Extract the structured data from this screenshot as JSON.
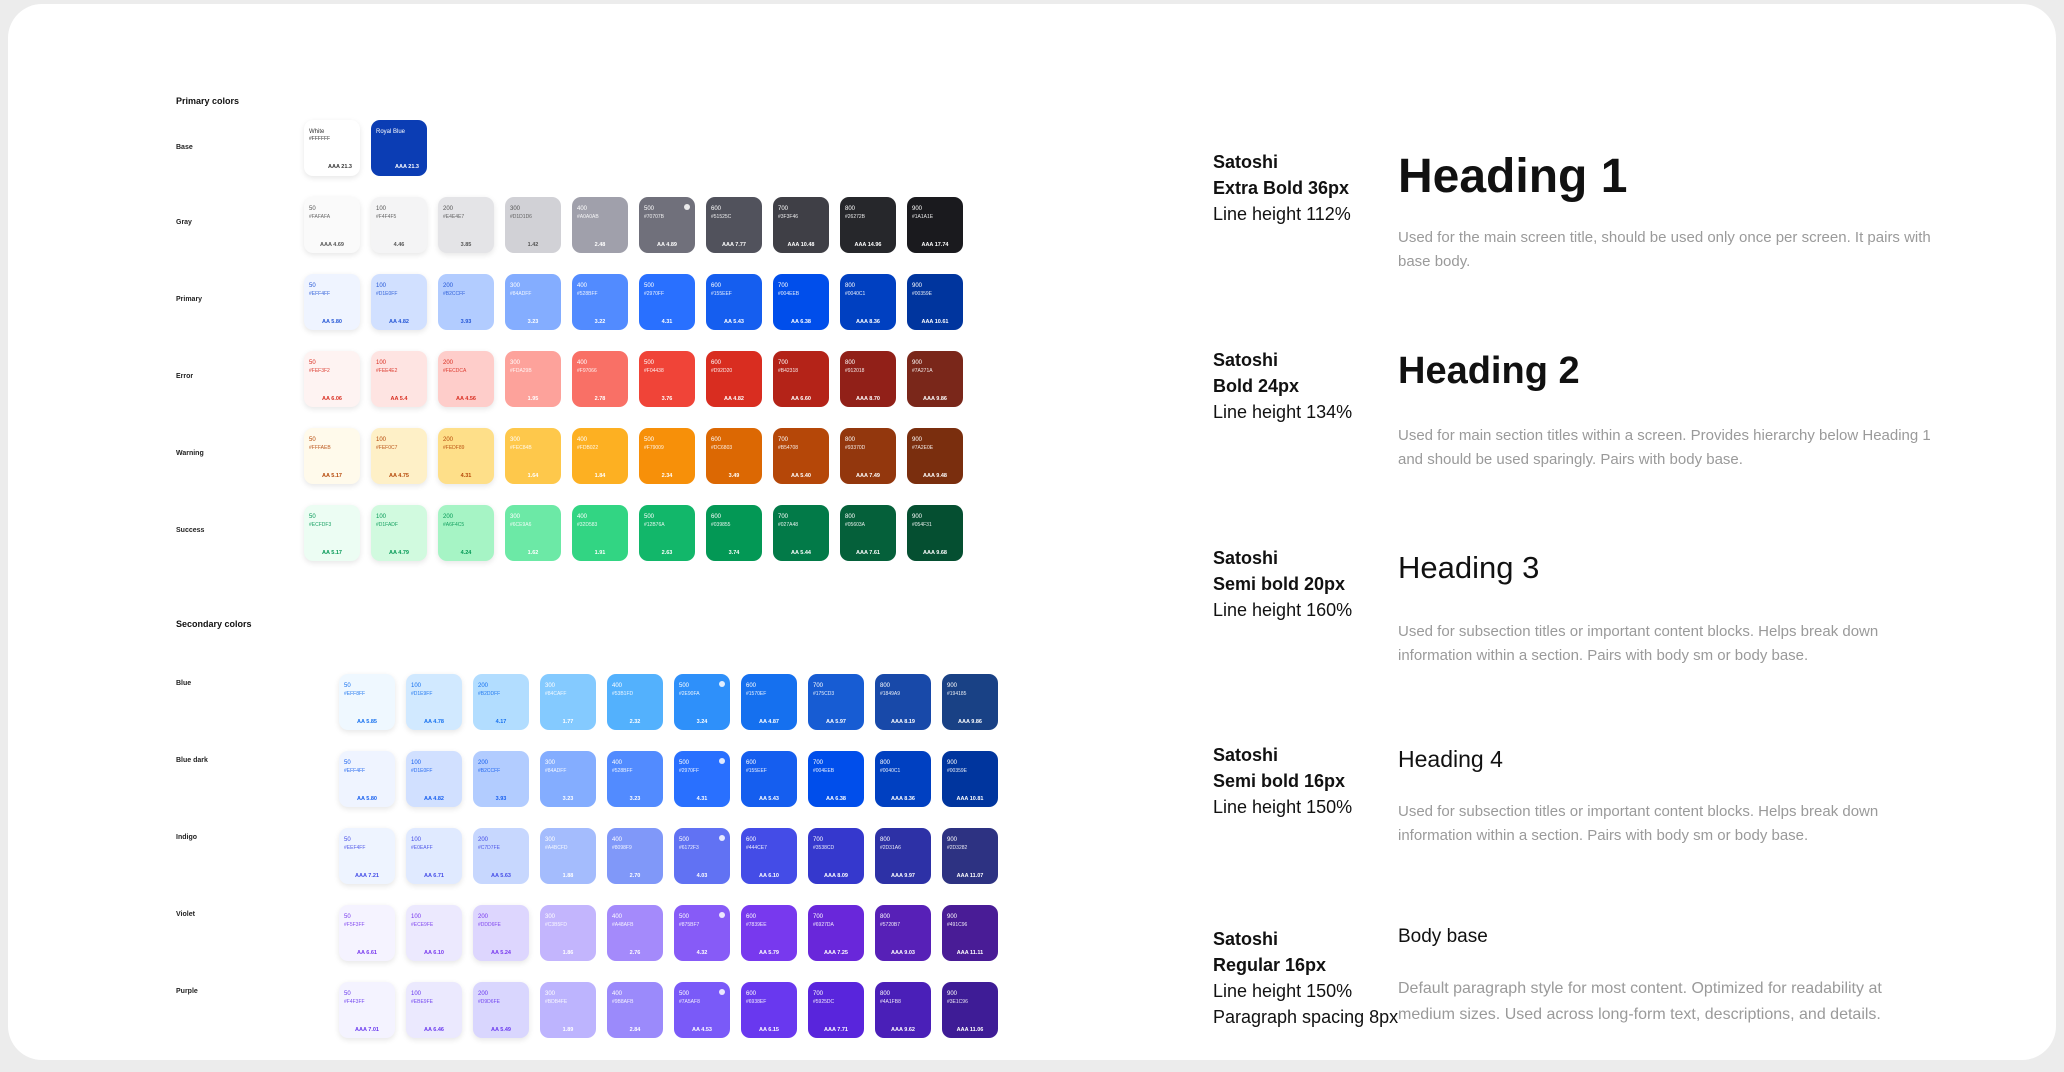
{
  "primary_title": "Primary colors",
  "secondary_title": "Secondary colors",
  "base_row": {
    "label": "Base",
    "swatches": [
      {
        "name": "White",
        "hex": "#FFFFFF",
        "ratio": "AAA 21.3",
        "bg": "#FFFFFF",
        "text": "#333333"
      },
      {
        "name": "Royal Blue",
        "hex": "",
        "ratio": "AAA 21.3",
        "bg": "#0B3DB4",
        "text": "#FFFFFF"
      }
    ]
  },
  "primary_rows": [
    {
      "label": "Gray",
      "swatches": [
        {
          "shade": "50",
          "hex": "#FAFAFA",
          "ratio": "AAA 4.69",
          "bg": "#FAFAFA",
          "text": "#555555"
        },
        {
          "shade": "100",
          "hex": "#F4F4F5",
          "ratio": "4.46",
          "bg": "#F4F4F5",
          "text": "#555555"
        },
        {
          "shade": "200",
          "hex": "#E4E4E7",
          "ratio": "3.85",
          "bg": "#E4E4E7",
          "text": "#555555"
        },
        {
          "shade": "300",
          "hex": "#D1D1D6",
          "ratio": "1.42",
          "bg": "#D1D1D6",
          "text": "#555555"
        },
        {
          "shade": "400",
          "hex": "#A0A0AB",
          "ratio": "2.48",
          "bg": "#A0A0AB",
          "text": "#FFFFFF"
        },
        {
          "shade": "500",
          "hex": "#70707B",
          "ratio": "AA 4.89",
          "bg": "#70707B",
          "text": "#FFFFFF",
          "dot": true
        },
        {
          "shade": "600",
          "hex": "#51525C",
          "ratio": "AAA 7.77",
          "bg": "#51525C",
          "text": "#FFFFFF"
        },
        {
          "shade": "700",
          "hex": "#3F3F46",
          "ratio": "AAA 10.48",
          "bg": "#3F3F46",
          "text": "#FFFFFF"
        },
        {
          "shade": "800",
          "hex": "#26272B",
          "ratio": "AAA 14.96",
          "bg": "#26272B",
          "text": "#FFFFFF"
        },
        {
          "shade": "900",
          "hex": "#1A1A1E",
          "ratio": "AAA 17.74",
          "bg": "#1A1A1E",
          "text": "#FFFFFF"
        }
      ]
    },
    {
      "label": "Primary",
      "swatches": [
        {
          "shade": "50",
          "hex": "#EFF4FF",
          "ratio": "AA 5.80",
          "bg": "#EFF4FF",
          "text": "#2456D6"
        },
        {
          "shade": "100",
          "hex": "#D1E0FF",
          "ratio": "AA 4.82",
          "bg": "#D1E0FF",
          "text": "#2456D6"
        },
        {
          "shade": "200",
          "hex": "#B2CCFF",
          "ratio": "3.93",
          "bg": "#B2CCFF",
          "text": "#2456D6"
        },
        {
          "shade": "300",
          "hex": "#84ADFF",
          "ratio": "3.23",
          "bg": "#84ADFF",
          "text": "#FFFFFF"
        },
        {
          "shade": "400",
          "hex": "#528BFF",
          "ratio": "3.22",
          "bg": "#528BFF",
          "text": "#FFFFFF"
        },
        {
          "shade": "500",
          "hex": "#2970FF",
          "ratio": "4.31",
          "bg": "#2970FF",
          "text": "#FFFFFF"
        },
        {
          "shade": "600",
          "hex": "#155EEF",
          "ratio": "AA 5.43",
          "bg": "#155EEF",
          "text": "#FFFFFF"
        },
        {
          "shade": "700",
          "hex": "#004EEB",
          "ratio": "AA 6.38",
          "bg": "#004EEB",
          "text": "#FFFFFF"
        },
        {
          "shade": "800",
          "hex": "#0040C1",
          "ratio": "AAA 8.36",
          "bg": "#0040C1",
          "text": "#FFFFFF"
        },
        {
          "shade": "900",
          "hex": "#00359E",
          "ratio": "AAA 10.61",
          "bg": "#00359E",
          "text": "#FFFFFF"
        }
      ]
    },
    {
      "label": "Error",
      "swatches": [
        {
          "shade": "50",
          "hex": "#FEF3F2",
          "ratio": "AA 6.06",
          "bg": "#FEF3F2",
          "text": "#D92D20"
        },
        {
          "shade": "100",
          "hex": "#FEE4E2",
          "ratio": "AA 5.4",
          "bg": "#FEE4E2",
          "text": "#D92D20"
        },
        {
          "shade": "200",
          "hex": "#FECDCA",
          "ratio": "AA 4.56",
          "bg": "#FECDCA",
          "text": "#D92D20"
        },
        {
          "shade": "300",
          "hex": "#FDA29B",
          "ratio": "1.95",
          "bg": "#FDA29B",
          "text": "#FFFFFF"
        },
        {
          "shade": "400",
          "hex": "#F97066",
          "ratio": "2.78",
          "bg": "#F97066",
          "text": "#FFFFFF"
        },
        {
          "shade": "500",
          "hex": "#F04438",
          "ratio": "3.76",
          "bg": "#F04438",
          "text": "#FFFFFF"
        },
        {
          "shade": "600",
          "hex": "#D92D20",
          "ratio": "AA 4.82",
          "bg": "#D92D20",
          "text": "#FFFFFF"
        },
        {
          "shade": "700",
          "hex": "#B42318",
          "ratio": "AA 6.60",
          "bg": "#B42318",
          "text": "#FFFFFF"
        },
        {
          "shade": "800",
          "hex": "#912018",
          "ratio": "AAA 8.70",
          "bg": "#912018",
          "text": "#FFFFFF"
        },
        {
          "shade": "900",
          "hex": "#7A271A",
          "ratio": "AAA 9.86",
          "bg": "#7A271A",
          "text": "#FFFFFF"
        }
      ]
    },
    {
      "label": "Warning",
      "swatches": [
        {
          "shade": "50",
          "hex": "#FFFAEB",
          "ratio": "AA 5.17",
          "bg": "#FFFAEB",
          "text": "#B54708"
        },
        {
          "shade": "100",
          "hex": "#FEF0C7",
          "ratio": "AA 4.75",
          "bg": "#FEF0C7",
          "text": "#B54708"
        },
        {
          "shade": "200",
          "hex": "#FEDF89",
          "ratio": "4.31",
          "bg": "#FEDF89",
          "text": "#B54708"
        },
        {
          "shade": "300",
          "hex": "#FEC84B",
          "ratio": "1.64",
          "bg": "#FEC84B",
          "text": "#FFFFFF"
        },
        {
          "shade": "400",
          "hex": "#FDB022",
          "ratio": "1.84",
          "bg": "#FDB022",
          "text": "#FFFFFF"
        },
        {
          "shade": "500",
          "hex": "#F79009",
          "ratio": "2.34",
          "bg": "#F79009",
          "text": "#FFFFFF"
        },
        {
          "shade": "600",
          "hex": "#DC6803",
          "ratio": "3.49",
          "bg": "#DC6803",
          "text": "#FFFFFF"
        },
        {
          "shade": "700",
          "hex": "#B54708",
          "ratio": "AA 5.40",
          "bg": "#B54708",
          "text": "#FFFFFF"
        },
        {
          "shade": "800",
          "hex": "#93370D",
          "ratio": "AAA 7.49",
          "bg": "#93370D",
          "text": "#FFFFFF"
        },
        {
          "shade": "900",
          "hex": "#7A2E0E",
          "ratio": "AAA 9.48",
          "bg": "#7A2E0E",
          "text": "#FFFFFF"
        }
      ]
    },
    {
      "label": "Success",
      "swatches": [
        {
          "shade": "50",
          "hex": "#ECFDF3",
          "ratio": "AA 5.17",
          "bg": "#ECFDF3",
          "text": "#039855"
        },
        {
          "shade": "100",
          "hex": "#D1FADF",
          "ratio": "AA 4.79",
          "bg": "#D1FADF",
          "text": "#039855"
        },
        {
          "shade": "200",
          "hex": "#A6F4C5",
          "ratio": "4.24",
          "bg": "#A6F4C5",
          "text": "#039855"
        },
        {
          "shade": "300",
          "hex": "#6CE9A6",
          "ratio": "1.62",
          "bg": "#6CE9A6",
          "text": "#FFFFFF"
        },
        {
          "shade": "400",
          "hex": "#32D583",
          "ratio": "1.91",
          "bg": "#32D583",
          "text": "#FFFFFF"
        },
        {
          "shade": "500",
          "hex": "#12B76A",
          "ratio": "2.63",
          "bg": "#12B76A",
          "text": "#FFFFFF"
        },
        {
          "shade": "600",
          "hex": "#039855",
          "ratio": "3.74",
          "bg": "#039855",
          "text": "#FFFFFF"
        },
        {
          "shade": "700",
          "hex": "#027A48",
          "ratio": "AA 5.44",
          "bg": "#027A48",
          "text": "#FFFFFF"
        },
        {
          "shade": "800",
          "hex": "#05603A",
          "ratio": "AAA 7.61",
          "bg": "#05603A",
          "text": "#FFFFFF"
        },
        {
          "shade": "900",
          "hex": "#054F31",
          "ratio": "AAA 9.68",
          "bg": "#054F31",
          "text": "#FFFFFF"
        }
      ]
    }
  ],
  "secondary_rows": [
    {
      "label": "Blue",
      "swatches": [
        {
          "shade": "50",
          "hex": "#EFF8FF",
          "ratio": "AA 5.85",
          "bg": "#EFF8FF",
          "text": "#1570EF"
        },
        {
          "shade": "100",
          "hex": "#D1E9FF",
          "ratio": "AA 4.78",
          "bg": "#D1E9FF",
          "text": "#1570EF"
        },
        {
          "shade": "200",
          "hex": "#B2DDFF",
          "ratio": "4.17",
          "bg": "#B2DDFF",
          "text": "#1570EF"
        },
        {
          "shade": "300",
          "hex": "#84CAFF",
          "ratio": "1.77",
          "bg": "#84CAFF",
          "text": "#FFFFFF"
        },
        {
          "shade": "400",
          "hex": "#53B1FD",
          "ratio": "2.32",
          "bg": "#53B1FD",
          "text": "#FFFFFF"
        },
        {
          "shade": "500",
          "hex": "#2E90FA",
          "ratio": "3.24",
          "bg": "#2E90FA",
          "text": "#FFFFFF",
          "dot": true
        },
        {
          "shade": "600",
          "hex": "#1570EF",
          "ratio": "AA 4.87",
          "bg": "#1570EF",
          "text": "#FFFFFF"
        },
        {
          "shade": "700",
          "hex": "#175CD3",
          "ratio": "AA 5.97",
          "bg": "#175CD3",
          "text": "#FFFFFF"
        },
        {
          "shade": "800",
          "hex": "#1849A9",
          "ratio": "AAA 8.19",
          "bg": "#1849A9",
          "text": "#FFFFFF"
        },
        {
          "shade": "900",
          "hex": "#194185",
          "ratio": "AAA 9.86",
          "bg": "#194185",
          "text": "#FFFFFF"
        }
      ]
    },
    {
      "label": "Blue dark",
      "swatches": [
        {
          "shade": "50",
          "hex": "#EFF4FF",
          "ratio": "AA 5.80",
          "bg": "#EFF4FF",
          "text": "#155EEF"
        },
        {
          "shade": "100",
          "hex": "#D1E0FF",
          "ratio": "AA 4.82",
          "bg": "#D1E0FF",
          "text": "#155EEF"
        },
        {
          "shade": "200",
          "hex": "#B2CCFF",
          "ratio": "3.93",
          "bg": "#B2CCFF",
          "text": "#155EEF"
        },
        {
          "shade": "300",
          "hex": "#84ADFF",
          "ratio": "3.23",
          "bg": "#84ADFF",
          "text": "#FFFFFF"
        },
        {
          "shade": "400",
          "hex": "#528BFF",
          "ratio": "3.23",
          "bg": "#528BFF",
          "text": "#FFFFFF"
        },
        {
          "shade": "500",
          "hex": "#2970FF",
          "ratio": "4.31",
          "bg": "#2970FF",
          "text": "#FFFFFF",
          "dot": true
        },
        {
          "shade": "600",
          "hex": "#155EEF",
          "ratio": "AA 5.43",
          "bg": "#155EEF",
          "text": "#FFFFFF"
        },
        {
          "shade": "700",
          "hex": "#004EEB",
          "ratio": "AA 6.38",
          "bg": "#004EEB",
          "text": "#FFFFFF"
        },
        {
          "shade": "800",
          "hex": "#0040C1",
          "ratio": "AAA 8.36",
          "bg": "#0040C1",
          "text": "#FFFFFF"
        },
        {
          "shade": "900",
          "hex": "#00359E",
          "ratio": "AAA 10.81",
          "bg": "#00359E",
          "text": "#FFFFFF"
        }
      ]
    },
    {
      "label": "Indigo",
      "swatches": [
        {
          "shade": "50",
          "hex": "#EEF4FF",
          "ratio": "AAA 7.21",
          "bg": "#EEF4FF",
          "text": "#444CE7"
        },
        {
          "shade": "100",
          "hex": "#E0EAFF",
          "ratio": "AA 6.71",
          "bg": "#E0EAFF",
          "text": "#444CE7"
        },
        {
          "shade": "200",
          "hex": "#C7D7FE",
          "ratio": "AA 5.63",
          "bg": "#C7D7FE",
          "text": "#444CE7"
        },
        {
          "shade": "300",
          "hex": "#A4BCFD",
          "ratio": "1.88",
          "bg": "#A4BCFD",
          "text": "#FFFFFF"
        },
        {
          "shade": "400",
          "hex": "#8098F9",
          "ratio": "2.70",
          "bg": "#8098F9",
          "text": "#FFFFFF"
        },
        {
          "shade": "500",
          "hex": "#6172F3",
          "ratio": "4.03",
          "bg": "#6172F3",
          "text": "#FFFFFF",
          "dot": true
        },
        {
          "shade": "600",
          "hex": "#444CE7",
          "ratio": "AA 6.10",
          "bg": "#444CE7",
          "text": "#FFFFFF"
        },
        {
          "shade": "700",
          "hex": "#3538CD",
          "ratio": "AAA 8.09",
          "bg": "#3538CD",
          "text": "#FFFFFF"
        },
        {
          "shade": "800",
          "hex": "#2D31A6",
          "ratio": "AAA 9.97",
          "bg": "#2D31A6",
          "text": "#FFFFFF"
        },
        {
          "shade": "900",
          "hex": "#2D3282",
          "ratio": "AAA 11.07",
          "bg": "#2D3282",
          "text": "#FFFFFF"
        }
      ]
    },
    {
      "label": "Violet",
      "swatches": [
        {
          "shade": "50",
          "hex": "#F5F3FF",
          "ratio": "AA 6.61",
          "bg": "#F5F3FF",
          "text": "#7839EE"
        },
        {
          "shade": "100",
          "hex": "#ECE9FE",
          "ratio": "AA 6.10",
          "bg": "#ECE9FE",
          "text": "#7839EE"
        },
        {
          "shade": "200",
          "hex": "#DDD6FE",
          "ratio": "AA 5.24",
          "bg": "#DDD6FE",
          "text": "#7839EE"
        },
        {
          "shade": "300",
          "hex": "#C3B5FD",
          "ratio": "1.86",
          "bg": "#C3B5FD",
          "text": "#FFFFFF"
        },
        {
          "shade": "400",
          "hex": "#A48AFB",
          "ratio": "2.76",
          "bg": "#A48AFB",
          "text": "#FFFFFF"
        },
        {
          "shade": "500",
          "hex": "#875BF7",
          "ratio": "4.32",
          "bg": "#875BF7",
          "text": "#FFFFFF",
          "dot": true
        },
        {
          "shade": "600",
          "hex": "#7839EE",
          "ratio": "AA 5.79",
          "bg": "#7839EE",
          "text": "#FFFFFF"
        },
        {
          "shade": "700",
          "hex": "#6927DA",
          "ratio": "AAA 7.25",
          "bg": "#6927DA",
          "text": "#FFFFFF"
        },
        {
          "shade": "800",
          "hex": "#5720B7",
          "ratio": "AAA 9.03",
          "bg": "#5720B7",
          "text": "#FFFFFF"
        },
        {
          "shade": "900",
          "hex": "#491C96",
          "ratio": "AAA 11.11",
          "bg": "#491C96",
          "text": "#FFFFFF"
        }
      ]
    },
    {
      "label": "Purple",
      "swatches": [
        {
          "shade": "50",
          "hex": "#F4F3FF",
          "ratio": "AAA 7.01",
          "bg": "#F4F3FF",
          "text": "#6938EF"
        },
        {
          "shade": "100",
          "hex": "#EBE9FE",
          "ratio": "AA 6.46",
          "bg": "#EBE9FE",
          "text": "#6938EF"
        },
        {
          "shade": "200",
          "hex": "#D9D6FE",
          "ratio": "AA 5.49",
          "bg": "#D9D6FE",
          "text": "#6938EF"
        },
        {
          "shade": "300",
          "hex": "#BDB4FE",
          "ratio": "1.89",
          "bg": "#BDB4FE",
          "text": "#FFFFFF"
        },
        {
          "shade": "400",
          "hex": "#9B8AFB",
          "ratio": "2.84",
          "bg": "#9B8AFB",
          "text": "#FFFFFF"
        },
        {
          "shade": "500",
          "hex": "#7A5AF8",
          "ratio": "AA 4.53",
          "bg": "#7A5AF8",
          "text": "#FFFFFF",
          "dot": true
        },
        {
          "shade": "600",
          "hex": "#6938EF",
          "ratio": "AA 6.15",
          "bg": "#6938EF",
          "text": "#FFFFFF"
        },
        {
          "shade": "700",
          "hex": "#5925DC",
          "ratio": "AAA 7.71",
          "bg": "#5925DC",
          "text": "#FFFFFF"
        },
        {
          "shade": "800",
          "hex": "#4A1FB8",
          "ratio": "AAA 9.62",
          "bg": "#4A1FB8",
          "text": "#FFFFFF"
        },
        {
          "shade": "900",
          "hex": "#3E1C96",
          "ratio": "AAA 11.06",
          "bg": "#3E1C96",
          "text": "#FFFFFF"
        }
      ]
    }
  ],
  "typography": [
    {
      "font": "Satoshi",
      "weight": "Extra Bold 36px",
      "line_height": "Line height 112%",
      "spacing": "",
      "heading": "Heading 1",
      "description": "Used for the main screen title, should be used only once per screen. It pairs with base body."
    },
    {
      "font": "Satoshi",
      "weight": "Bold 24px",
      "line_height": "Line height 134%",
      "spacing": "",
      "heading": "Heading 2",
      "description": "Used for main section titles within a screen. Provides hierarchy below Heading 1 and should be used sparingly. Pairs with body base."
    },
    {
      "font": "Satoshi",
      "weight": "Semi bold 20px",
      "line_height": "Line height 160%",
      "spacing": "",
      "heading": "Heading 3",
      "description": "Used for subsection titles or important content blocks. Helps break down information within a section. Pairs with body sm or body base."
    },
    {
      "font": "Satoshi",
      "weight": "Semi bold 16px",
      "line_height": "Line height 150%",
      "spacing": "",
      "heading": "Heading 4",
      "description": "Used for subsection titles or important content blocks. Helps break down information within a section. Pairs with body sm or body base."
    },
    {
      "font": "Satoshi",
      "weight": "Regular 16px",
      "line_height": "Line height 150%",
      "spacing": "Paragraph spacing 8px",
      "heading": "Body base",
      "description": "Default paragraph style for most content. Optimized for readability at medium sizes. Used across long-form text, descriptions, and details."
    }
  ]
}
